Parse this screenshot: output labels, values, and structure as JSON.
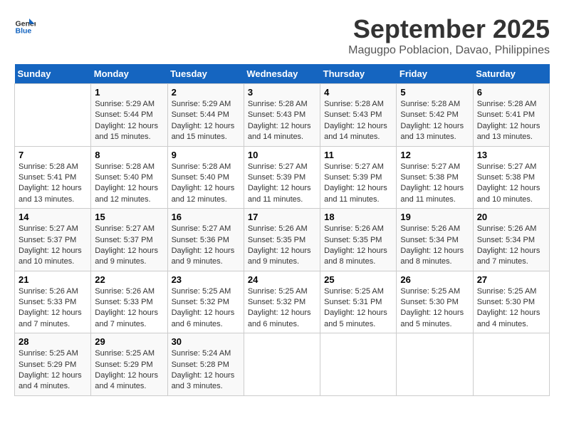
{
  "logo": {
    "line1": "General",
    "line2": "Blue"
  },
  "header": {
    "month": "September 2025",
    "location": "Magugpo Poblacion, Davao, Philippines"
  },
  "weekdays": [
    "Sunday",
    "Monday",
    "Tuesday",
    "Wednesday",
    "Thursday",
    "Friday",
    "Saturday"
  ],
  "weeks": [
    [
      {
        "day": "",
        "info": ""
      },
      {
        "day": "1",
        "info": "Sunrise: 5:29 AM\nSunset: 5:44 PM\nDaylight: 12 hours\nand 15 minutes."
      },
      {
        "day": "2",
        "info": "Sunrise: 5:29 AM\nSunset: 5:44 PM\nDaylight: 12 hours\nand 15 minutes."
      },
      {
        "day": "3",
        "info": "Sunrise: 5:28 AM\nSunset: 5:43 PM\nDaylight: 12 hours\nand 14 minutes."
      },
      {
        "day": "4",
        "info": "Sunrise: 5:28 AM\nSunset: 5:43 PM\nDaylight: 12 hours\nand 14 minutes."
      },
      {
        "day": "5",
        "info": "Sunrise: 5:28 AM\nSunset: 5:42 PM\nDaylight: 12 hours\nand 13 minutes."
      },
      {
        "day": "6",
        "info": "Sunrise: 5:28 AM\nSunset: 5:41 PM\nDaylight: 12 hours\nand 13 minutes."
      }
    ],
    [
      {
        "day": "7",
        "info": "Sunrise: 5:28 AM\nSunset: 5:41 PM\nDaylight: 12 hours\nand 13 minutes."
      },
      {
        "day": "8",
        "info": "Sunrise: 5:28 AM\nSunset: 5:40 PM\nDaylight: 12 hours\nand 12 minutes."
      },
      {
        "day": "9",
        "info": "Sunrise: 5:28 AM\nSunset: 5:40 PM\nDaylight: 12 hours\nand 12 minutes."
      },
      {
        "day": "10",
        "info": "Sunrise: 5:27 AM\nSunset: 5:39 PM\nDaylight: 12 hours\nand 11 minutes."
      },
      {
        "day": "11",
        "info": "Sunrise: 5:27 AM\nSunset: 5:39 PM\nDaylight: 12 hours\nand 11 minutes."
      },
      {
        "day": "12",
        "info": "Sunrise: 5:27 AM\nSunset: 5:38 PM\nDaylight: 12 hours\nand 11 minutes."
      },
      {
        "day": "13",
        "info": "Sunrise: 5:27 AM\nSunset: 5:38 PM\nDaylight: 12 hours\nand 10 minutes."
      }
    ],
    [
      {
        "day": "14",
        "info": "Sunrise: 5:27 AM\nSunset: 5:37 PM\nDaylight: 12 hours\nand 10 minutes."
      },
      {
        "day": "15",
        "info": "Sunrise: 5:27 AM\nSunset: 5:37 PM\nDaylight: 12 hours\nand 9 minutes."
      },
      {
        "day": "16",
        "info": "Sunrise: 5:27 AM\nSunset: 5:36 PM\nDaylight: 12 hours\nand 9 minutes."
      },
      {
        "day": "17",
        "info": "Sunrise: 5:26 AM\nSunset: 5:35 PM\nDaylight: 12 hours\nand 9 minutes."
      },
      {
        "day": "18",
        "info": "Sunrise: 5:26 AM\nSunset: 5:35 PM\nDaylight: 12 hours\nand 8 minutes."
      },
      {
        "day": "19",
        "info": "Sunrise: 5:26 AM\nSunset: 5:34 PM\nDaylight: 12 hours\nand 8 minutes."
      },
      {
        "day": "20",
        "info": "Sunrise: 5:26 AM\nSunset: 5:34 PM\nDaylight: 12 hours\nand 7 minutes."
      }
    ],
    [
      {
        "day": "21",
        "info": "Sunrise: 5:26 AM\nSunset: 5:33 PM\nDaylight: 12 hours\nand 7 minutes."
      },
      {
        "day": "22",
        "info": "Sunrise: 5:26 AM\nSunset: 5:33 PM\nDaylight: 12 hours\nand 7 minutes."
      },
      {
        "day": "23",
        "info": "Sunrise: 5:25 AM\nSunset: 5:32 PM\nDaylight: 12 hours\nand 6 minutes."
      },
      {
        "day": "24",
        "info": "Sunrise: 5:25 AM\nSunset: 5:32 PM\nDaylight: 12 hours\nand 6 minutes."
      },
      {
        "day": "25",
        "info": "Sunrise: 5:25 AM\nSunset: 5:31 PM\nDaylight: 12 hours\nand 5 minutes."
      },
      {
        "day": "26",
        "info": "Sunrise: 5:25 AM\nSunset: 5:30 PM\nDaylight: 12 hours\nand 5 minutes."
      },
      {
        "day": "27",
        "info": "Sunrise: 5:25 AM\nSunset: 5:30 PM\nDaylight: 12 hours\nand 4 minutes."
      }
    ],
    [
      {
        "day": "28",
        "info": "Sunrise: 5:25 AM\nSunset: 5:29 PM\nDaylight: 12 hours\nand 4 minutes."
      },
      {
        "day": "29",
        "info": "Sunrise: 5:25 AM\nSunset: 5:29 PM\nDaylight: 12 hours\nand 4 minutes."
      },
      {
        "day": "30",
        "info": "Sunrise: 5:24 AM\nSunset: 5:28 PM\nDaylight: 12 hours\nand 3 minutes."
      },
      {
        "day": "",
        "info": ""
      },
      {
        "day": "",
        "info": ""
      },
      {
        "day": "",
        "info": ""
      },
      {
        "day": "",
        "info": ""
      }
    ]
  ]
}
